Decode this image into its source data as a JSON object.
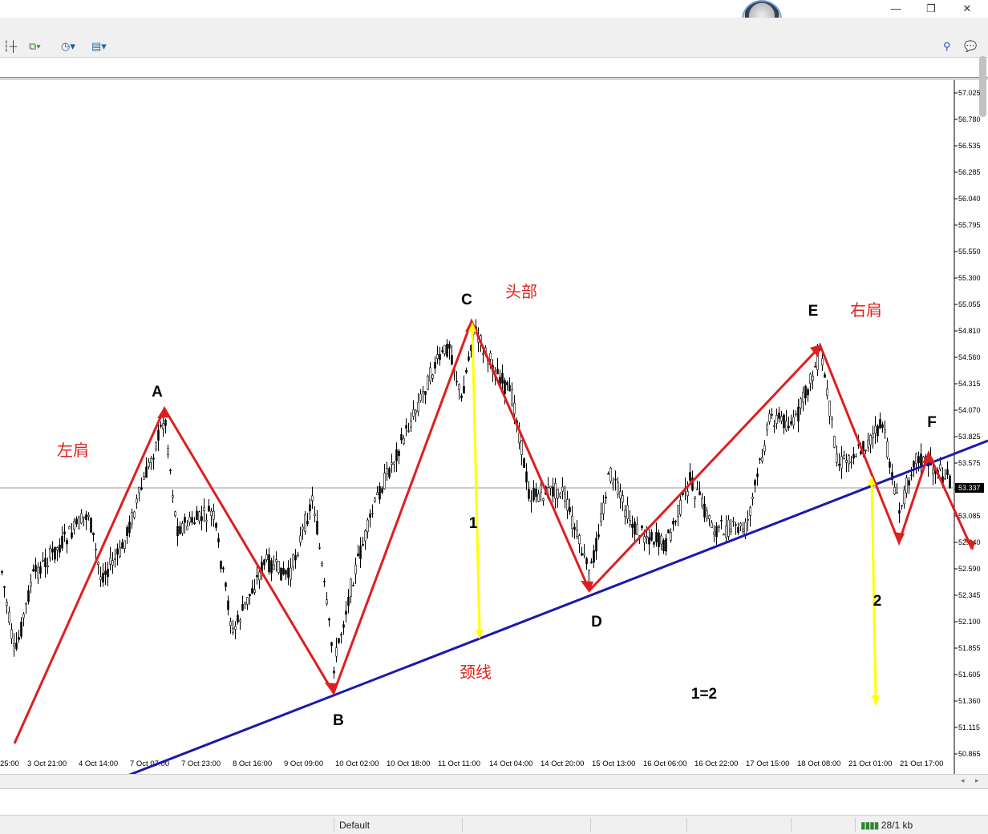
{
  "window": {
    "minimize": "—",
    "maximize": "❐",
    "close": "✕"
  },
  "status": {
    "profile": "Default",
    "traffic": "28/1 kb"
  },
  "chart_data": {
    "type": "candlestick",
    "price_axis": [
      "57.025",
      "56.780",
      "56.535",
      "56.285",
      "56.040",
      "55.795",
      "55.550",
      "55.300",
      "55.055",
      "54.810",
      "54.560",
      "54.315",
      "54.070",
      "53.825",
      "53.575",
      "53.337",
      "53.085",
      "52.840",
      "52.590",
      "52.345",
      "52.100",
      "51.855",
      "51.605",
      "51.360",
      "51.115",
      "50.865"
    ],
    "current_price": "53.337",
    "time_axis": [
      "25:00",
      "3 Oct 21:00",
      "4 Oct 14:00",
      "7 Oct 07:00",
      "7 Oct 23:00",
      "8 Oct 16:00",
      "9 Oct 09:00",
      "10 Oct 02:00",
      "10 Oct 18:00",
      "11 Oct 11:00",
      "14 Oct 04:00",
      "14 Oct 20:00",
      "15 Oct 13:00",
      "16 Oct 06:00",
      "16 Oct 22:00",
      "17 Oct 15:00",
      "18 Oct 08:00",
      "21 Oct 01:00",
      "21 Oct 17:00"
    ],
    "point_labels": [
      "A",
      "B",
      "C",
      "D",
      "E",
      "F"
    ],
    "annotations": {
      "left_shoulder": "左肩",
      "head": "头部",
      "right_shoulder": "右肩",
      "neckline": "颈线",
      "measure1": "1",
      "measure2": "2",
      "equality": "1=2"
    },
    "colors": {
      "pattern_line": "#dd1f1f",
      "neckline": "#1a1aaa",
      "measure": "#ffff00",
      "candles": "#000000",
      "text_red": "#e0221e"
    }
  }
}
